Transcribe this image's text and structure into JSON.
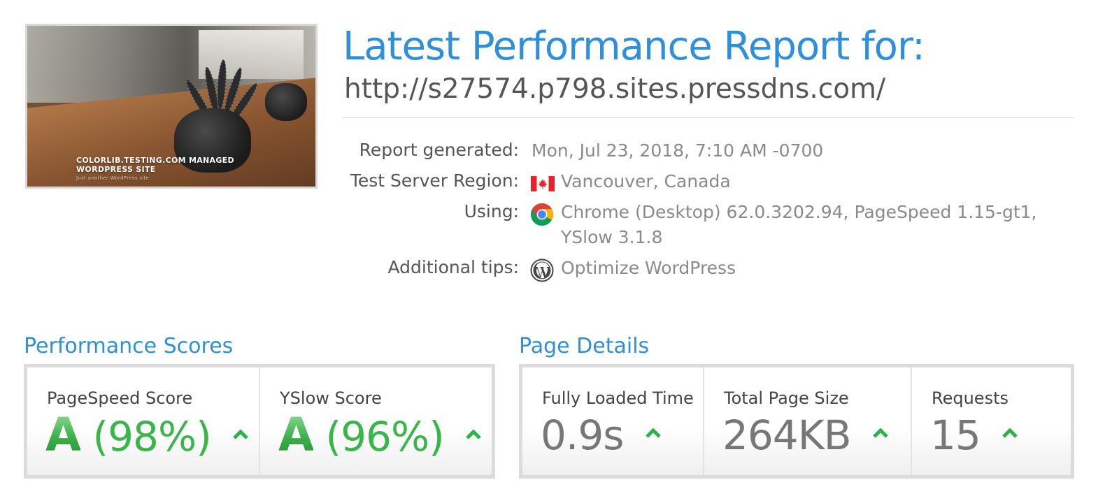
{
  "thumbnail": {
    "caption": "COLORLIB.TESTING.COM MANAGED WORDPRESS SITE",
    "subcaption": "Just another WordPress site"
  },
  "header": {
    "title": "Latest Performance Report for:",
    "url": "http://s27574.p798.sites.pressdns.com/"
  },
  "info": {
    "generated_label": "Report generated:",
    "generated_value": "Mon, Jul 23, 2018, 7:10 AM -0700",
    "region_label": "Test Server Region:",
    "region_value": "Vancouver, Canada",
    "region_icon": "canada-flag-icon",
    "using_label": "Using:",
    "using_value_line1": "Chrome (Desktop) 62.0.3202.94, PageSpeed 1.15-gt1,",
    "using_value_line2": "YSlow 3.1.8",
    "using_icon": "chrome-icon",
    "tips_label": "Additional tips:",
    "tips_value": "Optimize WordPress",
    "tips_icon": "wordpress-icon"
  },
  "performance": {
    "title": "Performance Scores",
    "pagespeed_label": "PageSpeed Score",
    "pagespeed_grade": "A",
    "pagespeed_pct": "(98%)",
    "yslow_label": "YSlow Score",
    "yslow_grade": "A",
    "yslow_pct": "(96%)"
  },
  "details": {
    "title": "Page Details",
    "load_label": "Fully Loaded Time",
    "load_value": "0.9s",
    "size_label": "Total Page Size",
    "size_value": "264KB",
    "requests_label": "Requests",
    "requests_value": "15"
  },
  "colors": {
    "accent_blue": "#2f8fd8",
    "grade_green": "#39b54a",
    "trend_up_green": "#2bb34a"
  }
}
